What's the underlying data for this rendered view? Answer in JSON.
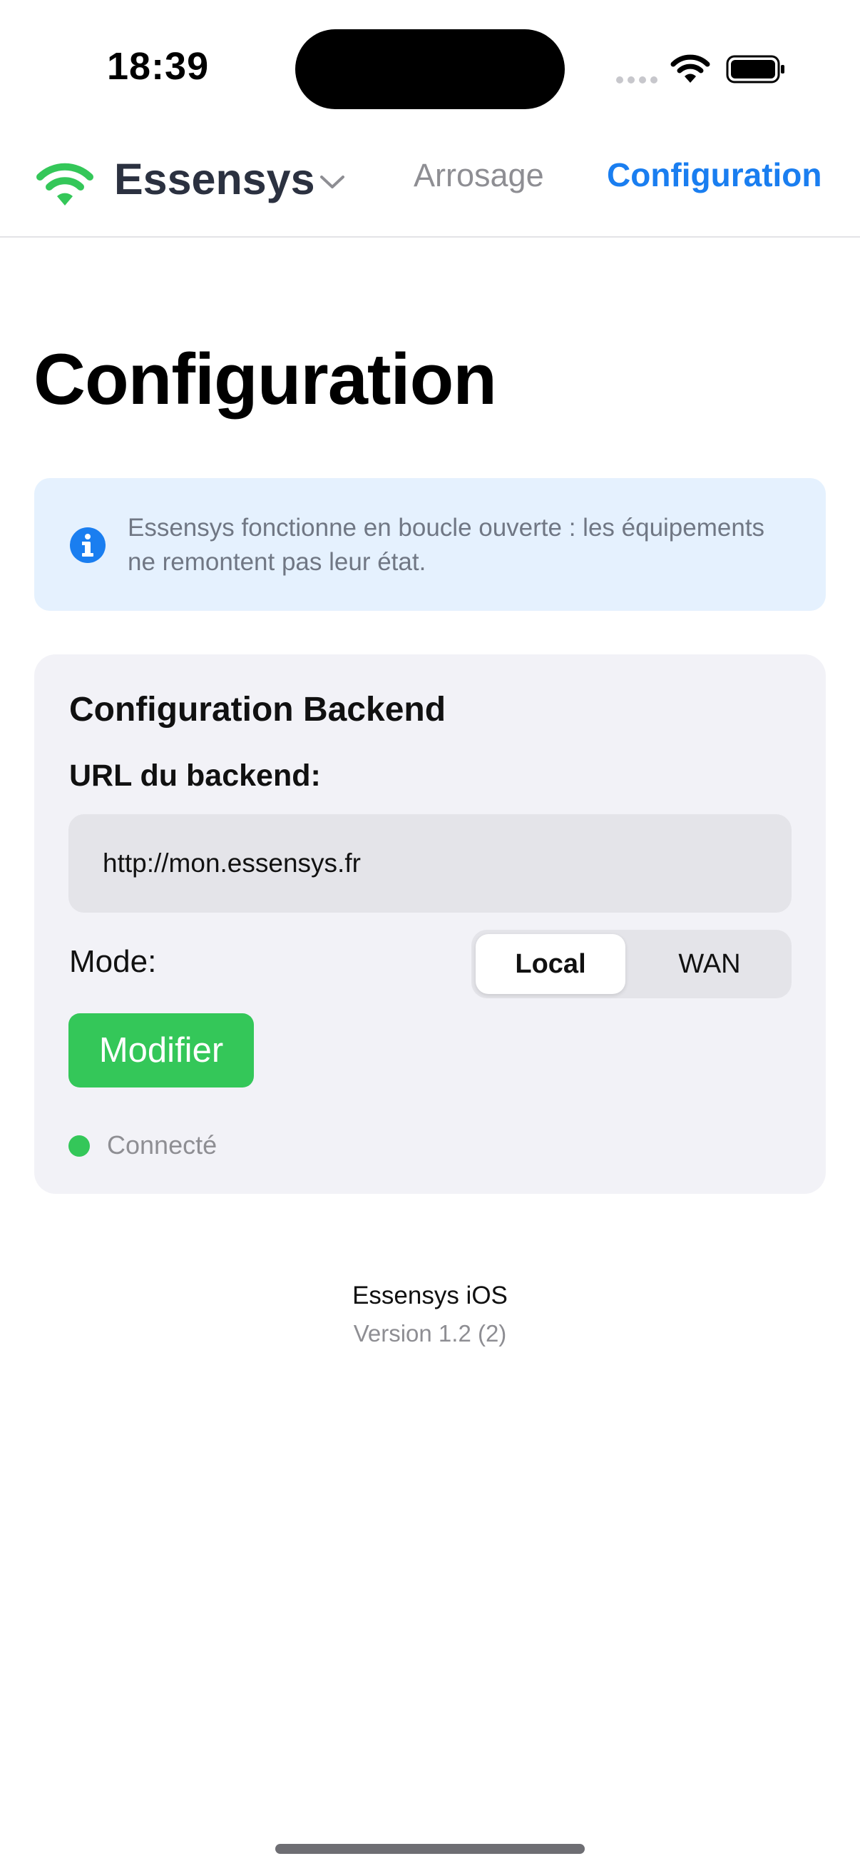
{
  "status_bar": {
    "time": "18:39"
  },
  "header": {
    "app_name": "Essensys",
    "brand_icon": "wifi-icon",
    "tabs": [
      {
        "label": "Arrosage",
        "active": false
      },
      {
        "label": "Configuration",
        "active": true
      }
    ],
    "colors": {
      "brand_icon": "#34c759",
      "active_tab": "#1a7ef0",
      "inactive_tab": "#8e8e93"
    }
  },
  "page": {
    "title": "Configuration"
  },
  "info_banner": {
    "icon": "info-icon",
    "text": "Essensys fonctionne en boucle ouverte : les équipements ne remontent pas leur état."
  },
  "backend_card": {
    "title": "Configuration Backend",
    "url_label": "URL du backend:",
    "url_value": "http://mon.essensys.fr",
    "mode_label": "Mode:",
    "mode_options": [
      "Local",
      "WAN"
    ],
    "mode_selected": "Local",
    "modify_button": "Modifier",
    "status_text": "Connecté",
    "status_color": "#34c759"
  },
  "footer": {
    "app_label": "Essensys iOS",
    "version": "Version 1.2 (2)"
  }
}
